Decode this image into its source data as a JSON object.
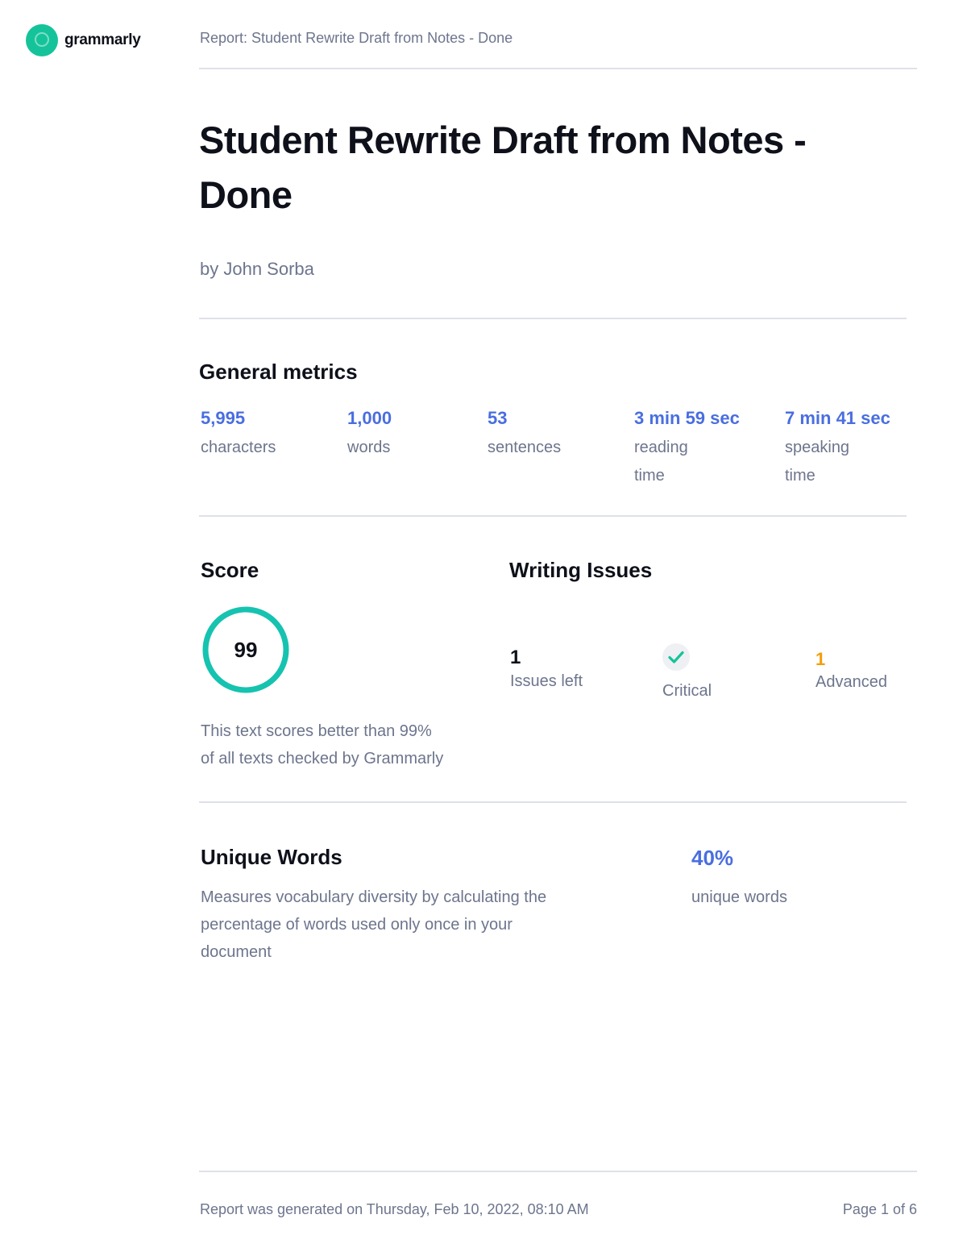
{
  "brand": {
    "name": "grammarly",
    "icon": "grammarly-logo-icon",
    "color": "#15c39a"
  },
  "header": {
    "title": "Report: Student Rewrite Draft from Notes - Done"
  },
  "document": {
    "title": "Student Rewrite Draft from Notes - Done",
    "author": "by John Sorba"
  },
  "general_metrics": {
    "heading": "General metrics",
    "items": [
      {
        "value": "5,995",
        "label": "characters"
      },
      {
        "value": "1,000",
        "label": "words"
      },
      {
        "value": "53",
        "label": "sentences"
      },
      {
        "value": "3 min 59 sec",
        "label_line1": "reading",
        "label_line2": "time"
      },
      {
        "value": "7 min 41 sec",
        "label_line1": "speaking",
        "label_line2": "time"
      }
    ]
  },
  "score": {
    "heading": "Score",
    "value": "99",
    "fraction": 0.99,
    "color": "#15c3b0",
    "line1": "This text scores better than 99%",
    "line2": "of all texts checked by Grammarly"
  },
  "writing_issues": {
    "heading": "Writing Issues",
    "issues_left": {
      "value": "1",
      "label": "Issues left"
    },
    "critical": {
      "icon": "checkmark-icon",
      "label": "Critical",
      "color": "#15c39a"
    },
    "advanced": {
      "value": "1",
      "label": "Advanced",
      "color": "#f29e0b"
    }
  },
  "unique_words": {
    "heading": "Unique Words",
    "line1": "Measures vocabulary diversity by calculating the",
    "line2": "percentage of words used only once in your",
    "line3": "document",
    "value": "40%",
    "label": "unique words"
  },
  "footer": {
    "generated": "Report was generated on Thursday, Feb 10, 2022, 08:10 AM",
    "page": "Page 1 of 6"
  }
}
